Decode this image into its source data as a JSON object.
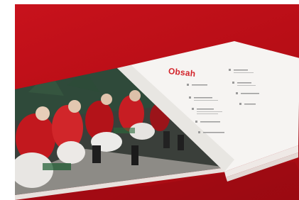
{
  "photo": {
    "subject": "open-book-with-table-of-contents",
    "colors": {
      "background": "#c0101a",
      "page": "#f6f4f2",
      "page_shadow": "#dedbd8",
      "title": "#d3242b",
      "toc_text": "#8a8a8a"
    }
  },
  "book": {
    "toc_title": "Obsah"
  }
}
